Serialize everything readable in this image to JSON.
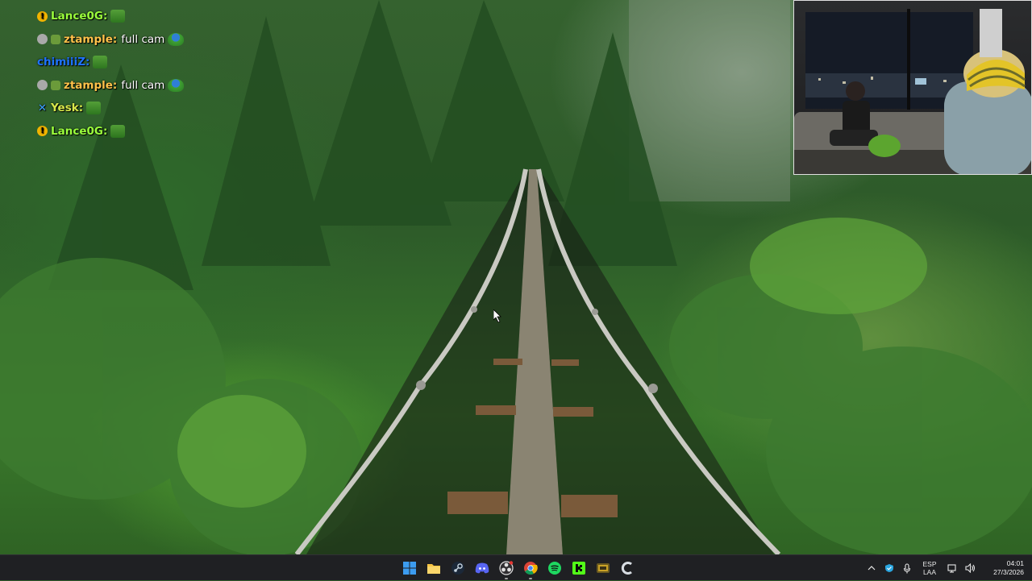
{
  "chat": {
    "messages": [
      {
        "badge": "!",
        "username": "Lance0G:",
        "text": ""
      },
      {
        "badge": "",
        "username": "ztample:",
        "text": "full cam"
      },
      {
        "badge": "",
        "username": "chimiiiZ:",
        "text": ""
      },
      {
        "badge": "",
        "username": "ztample:",
        "text": "full cam"
      },
      {
        "badge": "✕",
        "username": "Yesk:",
        "text": ""
      },
      {
        "badge": "!",
        "username": "Lance0G:",
        "text": ""
      }
    ]
  },
  "webcam": {
    "icon": "webcam-feed"
  },
  "wallpaper": {
    "subject": "forest-suspension-bridge"
  },
  "taskbar": {
    "apps": [
      {
        "name": "start",
        "icon": "windows-logo-icon",
        "color": "#3c9cf0"
      },
      {
        "name": "file-explorer",
        "icon": "folder-icon",
        "color": "#f6c443"
      },
      {
        "name": "steam",
        "icon": "steam-icon",
        "color": "#c7d5e0"
      },
      {
        "name": "discord",
        "icon": "discord-icon",
        "color": "#5865f2"
      },
      {
        "name": "obs",
        "icon": "obs-icon",
        "color": "#e0e0e0"
      },
      {
        "name": "chrome",
        "icon": "chrome-icon",
        "color": "#4caf50"
      },
      {
        "name": "spotify",
        "icon": "spotify-icon",
        "color": "#1ed760"
      },
      {
        "name": "kick",
        "icon": "kick-icon",
        "color": "#53fc18"
      },
      {
        "name": "game",
        "icon": "game-icon",
        "color": "#c9a227"
      },
      {
        "name": "app-c",
        "icon": "c-app-icon",
        "color": "#d8dde3"
      }
    ],
    "tray": {
      "lang_top": "ESP",
      "lang_bottom": "LAA",
      "time": "04:01",
      "date": "27/3/2026"
    }
  }
}
